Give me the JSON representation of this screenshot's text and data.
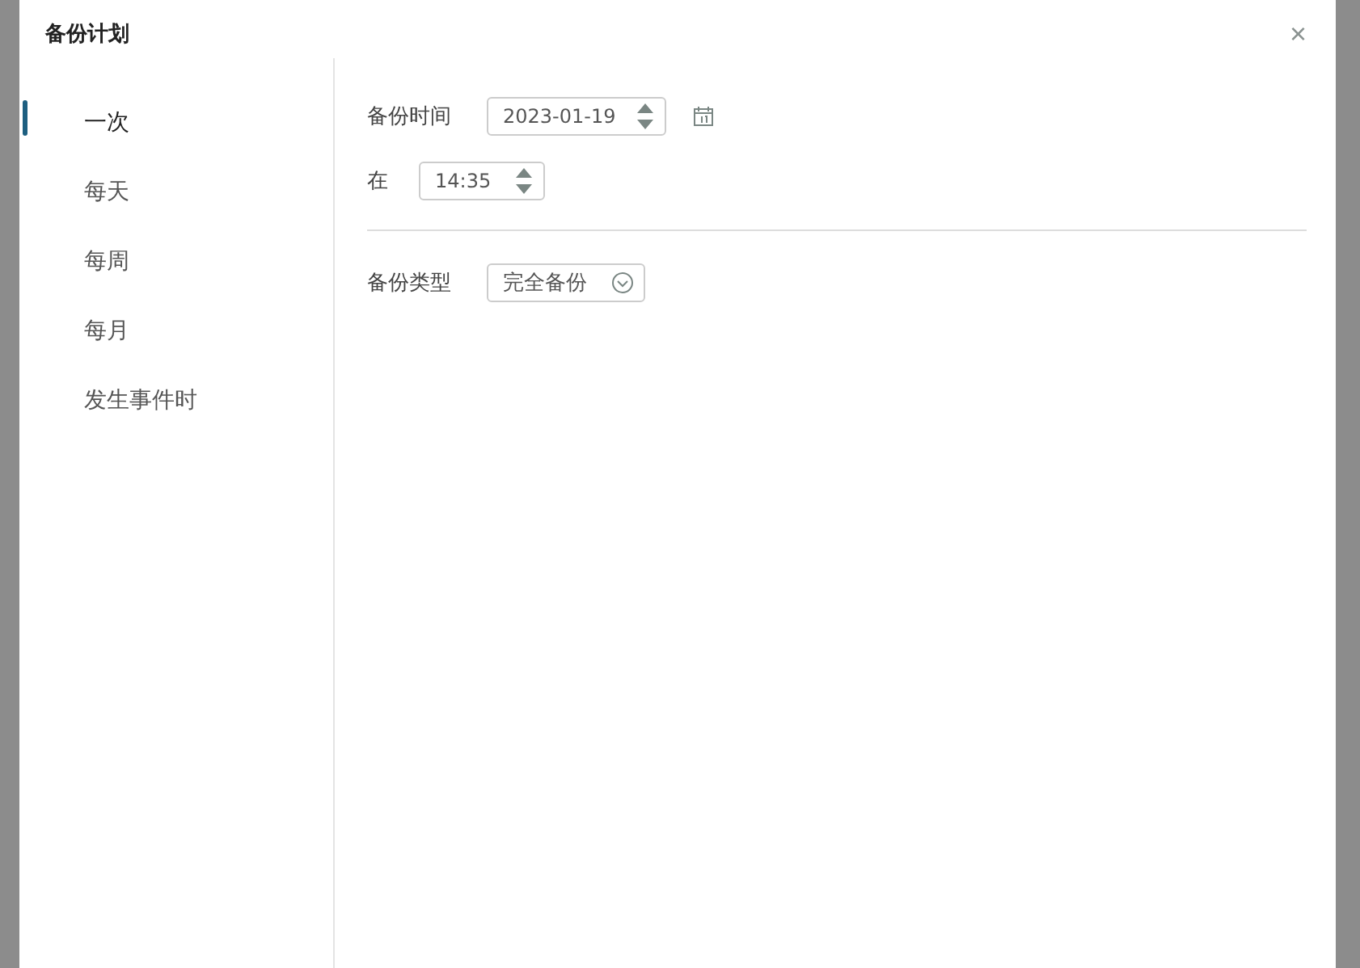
{
  "dialog": {
    "title": "备份计划",
    "close": "×"
  },
  "schedule_types": [
    {
      "label": "一次",
      "selected": true
    },
    {
      "label": "每天",
      "selected": false
    },
    {
      "label": "每周",
      "selected": false
    },
    {
      "label": "每月",
      "selected": false
    },
    {
      "label": "发生事件时",
      "selected": false
    }
  ],
  "backup_time": {
    "label": "备份时间",
    "date": "2023-01-19"
  },
  "at_time": {
    "label": "在",
    "time": "14:35"
  },
  "backup_type": {
    "label": "备份类型",
    "value": "完全备份"
  }
}
